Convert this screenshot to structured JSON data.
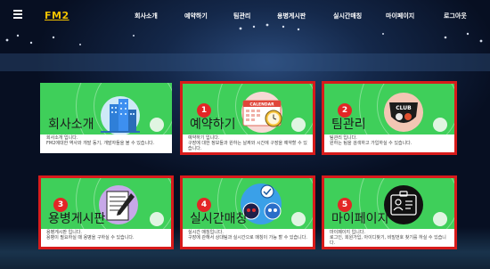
{
  "nav": {
    "logo": "FM2",
    "items": [
      "회사소개",
      "예약하기",
      "팀관리",
      "용병게시판",
      "실시간매칭",
      "마이페이지",
      "로그아웃"
    ]
  },
  "cards": [
    {
      "title": "회사소개",
      "desc": "회사소개 입니다.\nFM2에대한 역사와 개발 동기, 개발자들을 볼 수 있습니다.",
      "badge": ""
    },
    {
      "title": "예약하기",
      "desc": "예약하기 입니다.\n구장에 대한 정보들과 원하는 날짜와 시간에 구장을 예약할 수 있습니다.",
      "badge": "1"
    },
    {
      "title": "팀관리",
      "desc": "팀관리 입니다.\n원하는 팀을 검색하고 가입하실 수 있습니다.",
      "badge": "2"
    },
    {
      "title": "용병게시판",
      "desc": "용병게시판 입니다.\n용병이 필요하실 때 용병을 구하실 수 있습니다.",
      "badge": "3"
    },
    {
      "title": "실시간매칭",
      "desc": "실시간 매칭입니다.\n구장에 관해서 상대팀과 실시간으로 매칭이 가능 할 수 있습니다.",
      "badge": "4"
    },
    {
      "title": "마이페이지",
      "desc": "마이페이지 입니다.\n로그인, 회원가입, 아이디찾기, 비밀번호 찾기를 하실 수 있습니다.",
      "badge": "5"
    }
  ],
  "icons": {
    "calendar_label": "CALENDAR",
    "club_label": "CLUB"
  },
  "colors": {
    "card_green": "#3fcf5a",
    "highlight_red": "#d81b1b",
    "logo_yellow": "#f2c200"
  }
}
